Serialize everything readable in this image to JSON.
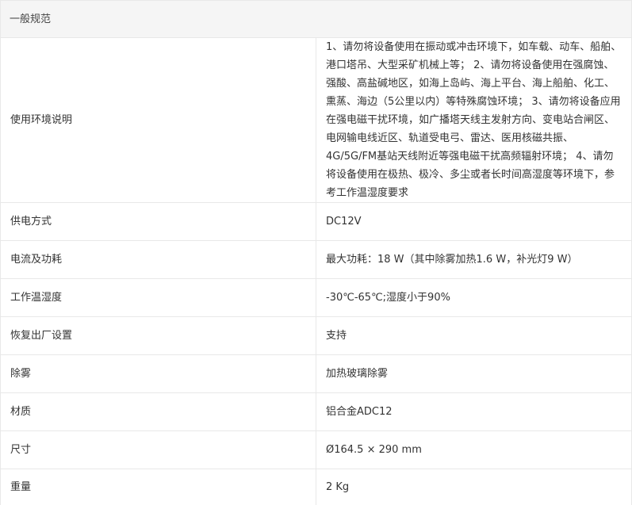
{
  "section_title": "一般规范",
  "rows": [
    {
      "label": "使用环境说明",
      "value": "1、请勿将设备使用在振动或冲击环境下，如车载、动车、船舶、港口塔吊、大型采矿机械上等； 2、请勿将设备使用在强腐蚀、强酸、高盐碱地区，如海上岛屿、海上平台、海上船舶、化工、熏蒸、海边（5公里以内）等特殊腐蚀环境； 3、请勿将设备应用在强电磁干扰环境，如广播塔天线主发射方向、变电站合闸区、电网输电线近区、轨道受电弓、雷达、医用核磁共振、4G/5G/FM基站天线附近等强电磁干扰高频辐射环境； 4、请勿将设备使用在极热、极冷、多尘或者长时间高湿度等环境下，参考工作温湿度要求"
    },
    {
      "label": "供电方式",
      "value": "DC12V"
    },
    {
      "label": "电流及功耗",
      "value": "最大功耗：18 W（其中除雾加热1.6 W，补光灯9 W）"
    },
    {
      "label": "工作温湿度",
      "value": "-30℃-65℃;湿度小于90%"
    },
    {
      "label": "恢复出厂设置",
      "value": "支持"
    },
    {
      "label": "除雾",
      "value": "加热玻璃除雾"
    },
    {
      "label": "材质",
      "value": "铝合金ADC12"
    },
    {
      "label": "尺寸",
      "value": "Ø164.5 × 290 mm"
    },
    {
      "label": "重量",
      "value": "2 Kg"
    }
  ]
}
